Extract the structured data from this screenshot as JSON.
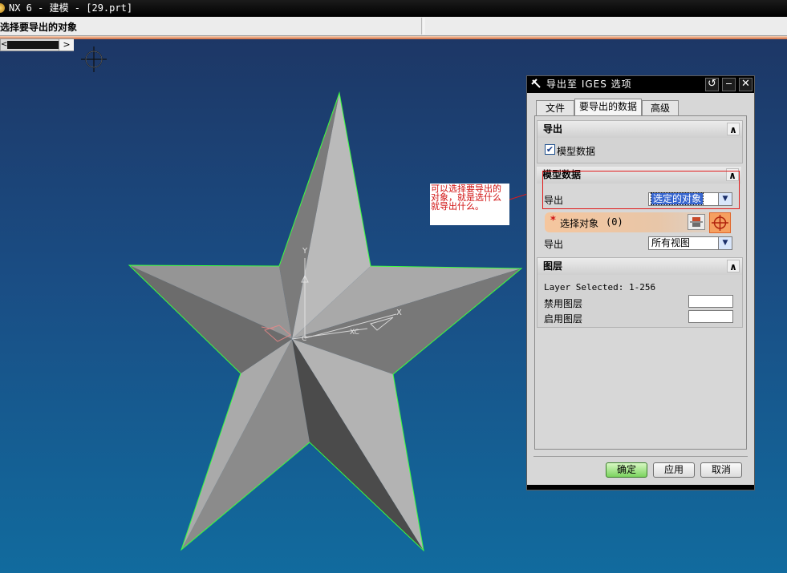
{
  "window": {
    "title": "NX 6 - 建模 - [29.prt]"
  },
  "cue_line": {
    "text": "选择要导出的对象"
  },
  "annotation": {
    "lines": [
      "可以选择要导出的",
      "对象，就是选什么",
      "就导出什么。"
    ]
  },
  "axes": {
    "x": "X",
    "y": "Y",
    "xc": "XC",
    "zc": "C"
  },
  "dialog": {
    "title": "导出至 IGES 选项",
    "tabs": [
      {
        "label": "文件",
        "active": false
      },
      {
        "label": "要导出的数据",
        "active": true
      },
      {
        "label": "高级",
        "active": false
      }
    ],
    "groups": {
      "export": {
        "title": "导出",
        "model_data_checkbox": {
          "label": "模型数据",
          "checked": true
        }
      },
      "model_data": {
        "title": "模型数据",
        "export_label": "导出",
        "export_value": "选定的对象",
        "select_required": "*",
        "select_label": "选择对象",
        "select_count": "(0)",
        "export2_label": "导出",
        "export2_value": "所有视图"
      },
      "layers": {
        "title": "图层",
        "layer_selected": "Layer Selected: 1-256",
        "disabled_label": "禁用图层",
        "enabled_label": "启用图层",
        "disabled_value": "",
        "enabled_value": ""
      }
    },
    "buttons": {
      "ok": "确定",
      "apply": "应用",
      "cancel": "取消"
    },
    "header_icons": [
      "pin-icon",
      "reset-icon",
      "minimize-icon",
      "close-icon"
    ]
  },
  "colors": {
    "accent_orange": "#e0672c",
    "annotation_red": "#d01010",
    "edge_green": "#3cff3c"
  }
}
